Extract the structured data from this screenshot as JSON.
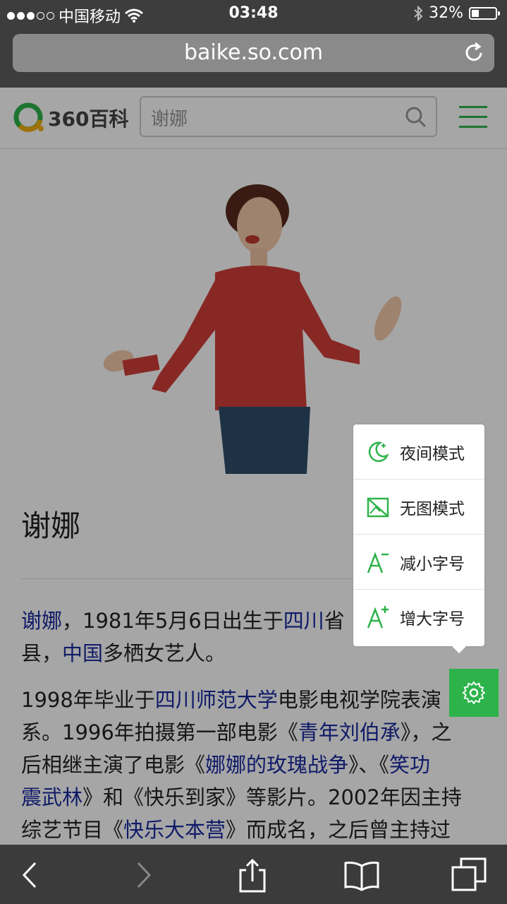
{
  "status_bar": {
    "carrier": "中国移动",
    "time": "03:48",
    "battery": "32%",
    "battery_level": 0.32,
    "signal_bars_filled": 3,
    "signal_bars_total": 5
  },
  "browser": {
    "url": "baike.so.com"
  },
  "header": {
    "logo_text": "360百科",
    "search_value": "谢娜"
  },
  "article": {
    "title": "谢娜",
    "p1": {
      "link1": "谢娜",
      "t1": "，1981年5月6日出生于",
      "link2": "四川",
      "t2": "省",
      "t3": "县，",
      "link3": "中国",
      "t4": "多栖女艺人。"
    },
    "p2": {
      "t1": "1998年毕业于",
      "link1": "四川师范大学",
      "t2": "电影电视学院表演",
      "t3": "系。1996年拍摄第一部电影《",
      "link2": "青年刘伯承",
      "t4": "》，之",
      "t5": "后相继主演了电影《",
      "link3": "娜娜的玫瑰战争",
      "t6": "》、《",
      "link4": "笑功",
      "t7": "震武林",
      "t8": "》和《快乐到家》等影片。2002年因主持",
      "t9": "综艺节目《",
      "link5": "快乐大本营",
      "t10": "》而成名，之后曾主持过"
    }
  },
  "popup_menu": {
    "items": [
      {
        "label": "夜间模式",
        "icon": "moon-icon"
      },
      {
        "label": "无图模式",
        "icon": "no-image-icon"
      },
      {
        "label": "减小字号",
        "icon": "decrease-font-icon"
      },
      {
        "label": "增大字号",
        "icon": "increase-font-icon"
      }
    ]
  },
  "colors": {
    "accent": "#2db34a",
    "link": "#1a2aa0",
    "status_bar": "#3d3d3d"
  }
}
